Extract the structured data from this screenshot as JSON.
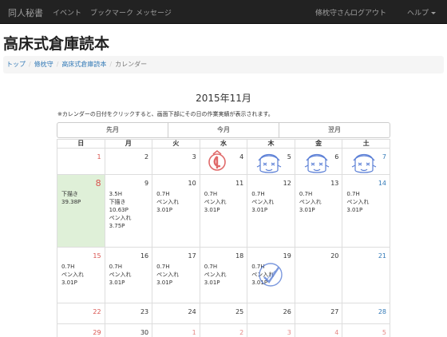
{
  "navbar": {
    "brand": "同人秘書",
    "items": [
      "イベント",
      "ブックマーク",
      "メッセージ"
    ],
    "user": "條枕守さん",
    "logout": "ログアウト",
    "help": "ヘルプ"
  },
  "page_title": "高床式倉庫読本",
  "breadcrumb": [
    "トップ",
    "條枕守",
    "高床式倉庫読本",
    "カレンダー"
  ],
  "calendar": {
    "heading": "2015年11月",
    "note": "※カレンダーの日付をクリックすると、画面下部にその日の作業実績が表示されます。",
    "nav": {
      "prev": "先月",
      "current": "今月",
      "next": "翌月"
    },
    "weekdays": [
      "日",
      "月",
      "火",
      "水",
      "木",
      "金",
      "土"
    ],
    "weeks": [
      [
        {
          "day": "1",
          "lines": []
        },
        {
          "day": "2",
          "lines": []
        },
        {
          "day": "3",
          "lines": []
        },
        {
          "day": "4",
          "lines": []
        },
        {
          "day": "5",
          "lines": []
        },
        {
          "day": "6",
          "lines": []
        },
        {
          "day": "7",
          "lines": []
        }
      ],
      [
        {
          "day": "8",
          "lines": [
            "下描き",
            "39.38P"
          ]
        },
        {
          "day": "9",
          "lines": [
            "3.5H",
            "下描き",
            "10.63P",
            "ペン入れ",
            "3.75P"
          ]
        },
        {
          "day": "10",
          "lines": [
            "0.7H",
            "ペン入れ",
            "3.01P"
          ]
        },
        {
          "day": "11",
          "lines": [
            "0.7H",
            "ペン入れ",
            "3.01P"
          ]
        },
        {
          "day": "12",
          "lines": [
            "0.7H",
            "ペン入れ",
            "3.01P"
          ]
        },
        {
          "day": "13",
          "lines": [
            "0.7H",
            "ペン入れ",
            "3.01P"
          ]
        },
        {
          "day": "14",
          "lines": [
            "0.7H",
            "ペン入れ",
            "3.01P"
          ]
        }
      ],
      [
        {
          "day": "15",
          "lines": [
            "0.7H",
            "ペン入れ",
            "3.01P"
          ]
        },
        {
          "day": "16",
          "lines": [
            "0.7H",
            "ペン入れ",
            "3.01P"
          ]
        },
        {
          "day": "17",
          "lines": [
            "0.7H",
            "ペン入れ",
            "3.01P"
          ]
        },
        {
          "day": "18",
          "lines": [
            "0.7H",
            "ペン入れ",
            "3.01P"
          ]
        },
        {
          "day": "19",
          "lines": [
            "0.7H",
            "ペン入れ",
            "3.01P"
          ]
        },
        {
          "day": "20",
          "lines": []
        },
        {
          "day": "21",
          "lines": []
        }
      ],
      [
        {
          "day": "22",
          "lines": []
        },
        {
          "day": "23",
          "lines": []
        },
        {
          "day": "24",
          "lines": []
        },
        {
          "day": "25",
          "lines": []
        },
        {
          "day": "26",
          "lines": []
        },
        {
          "day": "27",
          "lines": []
        },
        {
          "day": "28",
          "lines": []
        }
      ],
      [
        {
          "day": "29",
          "lines": []
        },
        {
          "day": "30",
          "lines": []
        },
        {
          "day": "1",
          "lines": []
        },
        {
          "day": "2",
          "lines": []
        },
        {
          "day": "3",
          "lines": []
        },
        {
          "day": "4",
          "lines": []
        },
        {
          "day": "5",
          "lines": []
        }
      ]
    ]
  },
  "colors": {
    "navbar_bg": "#222222",
    "link": "#337ab7",
    "sunday": "#d9534f",
    "saturday": "#337ab7",
    "today_bg": "#dff0d8",
    "stamp_red": "#e06a6a",
    "stamp_blue": "#5b7fd6"
  },
  "stamps": {
    "wed_week1": "red-character-stamp-icon",
    "thu_fri_sat_week1": "blue-face-stamp-icon",
    "thu_week3": "blue-check-stamp-icon"
  }
}
